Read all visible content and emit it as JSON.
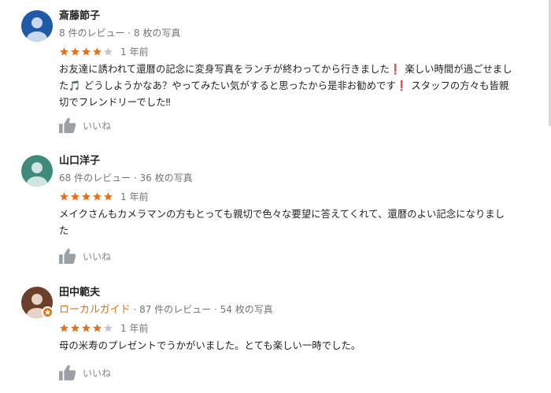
{
  "reviews": [
    {
      "name": "斎藤節子",
      "meta": "8 件のレビュー · 8 枚の写真",
      "local_guide": "",
      "rating": 4,
      "date": "1 年前",
      "text_lines": [
        "お友達に誘われて還暦の記念に変身写真をランチが終わってから行きました❗ 楽しい時間が過ごせまし",
        "た🎵 どうしようかなあ？やってみたい気がすると思ったから是非お勧めです❗ スタッフの方々も皆親",
        "切でフレンドリーでした‼"
      ],
      "like_label": "いいね",
      "avatar_color": "#1e5aa8"
    },
    {
      "name": "山口洋子",
      "meta": "68 件のレビュー · 36 枚の写真",
      "local_guide": "",
      "rating": 5,
      "date": "1 年前",
      "text_lines": [
        "メイクさんもカメラマンの方もとっても親切で色々な要望に答えてくれて、還暦のよい記念になりまし",
        "た"
      ],
      "like_label": "いいね",
      "avatar_color": "#3e8b7d"
    },
    {
      "name": "田中範夫",
      "meta": "· 87 件のレビュー · 54 枚の写真",
      "local_guide": "ローカルガイド",
      "rating": 4,
      "date": "1 年前",
      "text_lines": [
        "母の米寿のプレゼントでうかがいました。とても楽しい一時でした。"
      ],
      "like_label": "いいね",
      "avatar_color": "#6b3f2a"
    }
  ],
  "colors": {
    "star_filled": "#e7711b",
    "star_empty": "#c6c6c6",
    "meta_gray": "#70757a",
    "local_guide": "#e8710a"
  }
}
